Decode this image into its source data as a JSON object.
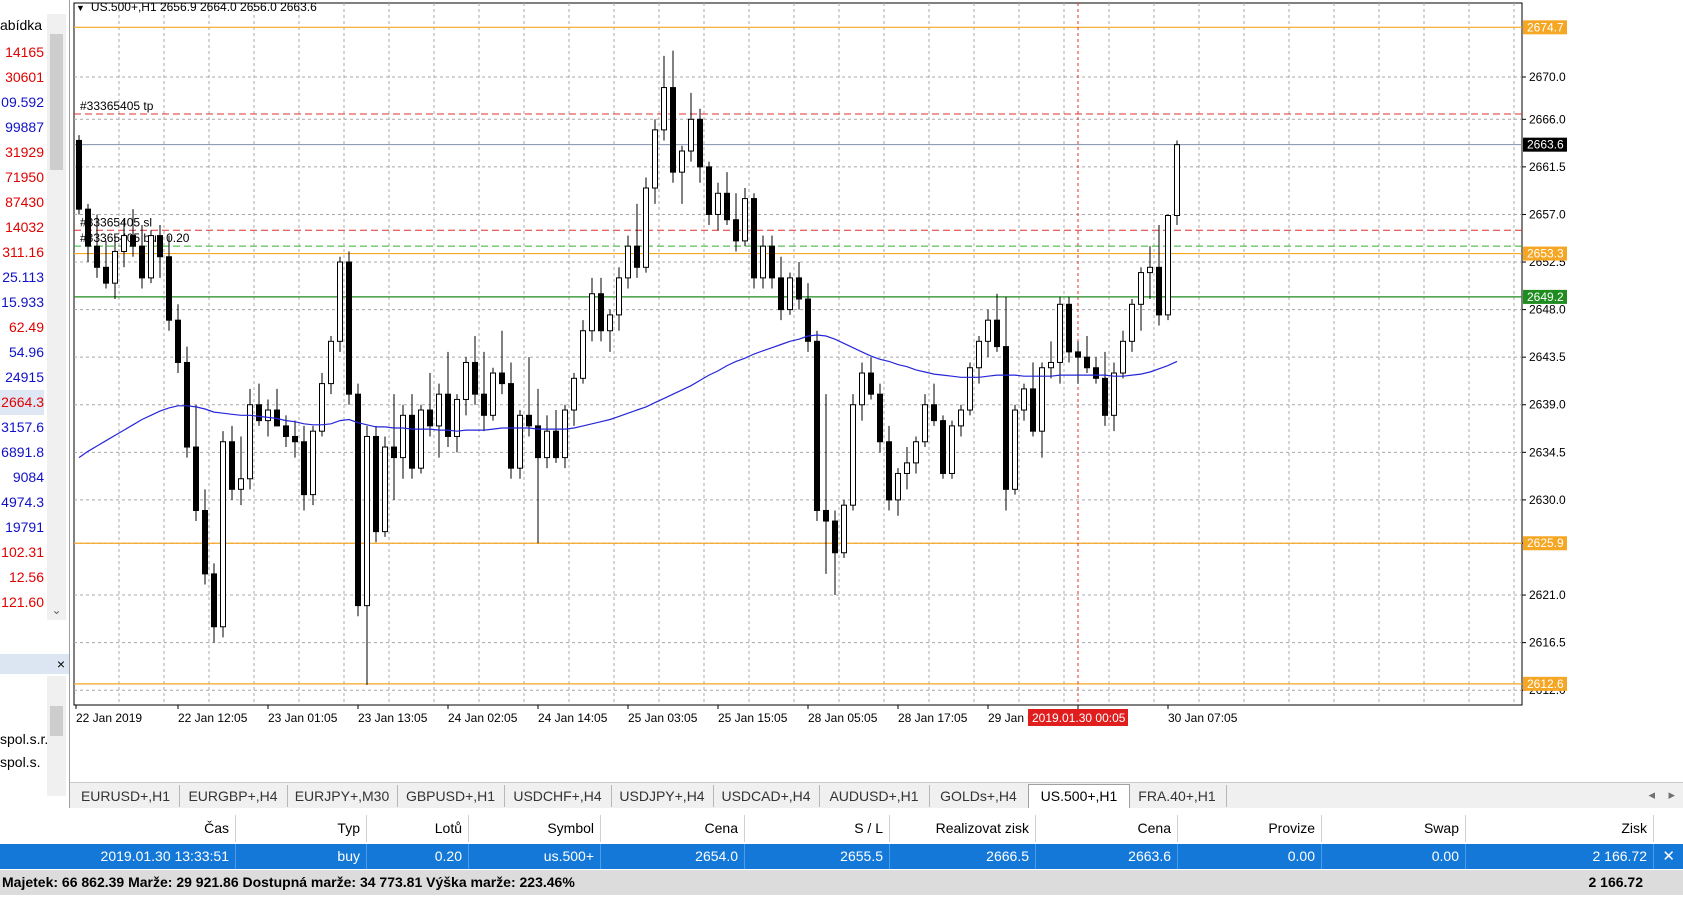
{
  "market_watch": {
    "header": "abídka",
    "rows": [
      {
        "value": "14165",
        "color": "#e00000"
      },
      {
        "value": "30601",
        "color": "#e00000"
      },
      {
        "value": "09.592",
        "color": "#1010c8"
      },
      {
        "value": "99887",
        "color": "#1010c8"
      },
      {
        "value": "31929",
        "color": "#e00000"
      },
      {
        "value": "71950",
        "color": "#e00000"
      },
      {
        "value": "87430",
        "color": "#e00000"
      },
      {
        "value": "14032",
        "color": "#e00000"
      },
      {
        "value": "311.16",
        "color": "#e00000"
      },
      {
        "value": "25.113",
        "color": "#1010c8"
      },
      {
        "value": "15.933",
        "color": "#1010c8"
      },
      {
        "value": "62.49",
        "color": "#e00000"
      },
      {
        "value": "54.96",
        "color": "#1010c8"
      },
      {
        "value": "24915",
        "color": "#1010c8"
      },
      {
        "value": "2664.3",
        "color": "#e00000"
      },
      {
        "value": "3157.6",
        "color": "#1010c8"
      },
      {
        "value": "6891.8",
        "color": "#1010c8"
      },
      {
        "value": "9084",
        "color": "#1010c8"
      },
      {
        "value": "4974.3",
        "color": "#1010c8"
      },
      {
        "value": "19791",
        "color": "#1010c8"
      },
      {
        "value": "102.31",
        "color": "#e00000"
      },
      {
        "value": "12.56",
        "color": "#e00000"
      },
      {
        "value": "121.60",
        "color": "#e00000"
      }
    ]
  },
  "navigator": {
    "close": "×",
    "account1": "spol.s.r.",
    "account2": "spol.s."
  },
  "chart": {
    "title": "US.500+,H1  2656.9 2664.0 2656.0 2663.6",
    "tp_label": "#33365405 tp",
    "sl_label": "#33365405 sl",
    "order_label": "#33365405 buy 0.20"
  },
  "chart_data": {
    "type": "candlestick",
    "symbol": "US.500+",
    "timeframe": "H1",
    "ylim": [
      2610.6,
      2677.0
    ],
    "y_ticks": [
      2670.0,
      2666.0,
      2661.5,
      2657.0,
      2652.5,
      2648.0,
      2643.5,
      2639.0,
      2634.5,
      2630.0,
      2625.9,
      2621.0,
      2616.5,
      2612.0
    ],
    "x_ticks": [
      "22 Jan 2019",
      "22 Jan 12:05",
      "23 Jan 01:05",
      "23 Jan 13:05",
      "24 Jan 02:05",
      "24 Jan 14:05",
      "25 Jan 03:05",
      "25 Jan 15:05",
      "28 Jan 05:05",
      "28 Jan 17:05",
      "29 Jan 06:05",
      "2019.01.30 00:05",
      "30 Jan 07:05"
    ],
    "x_tick_index": [
      0,
      11,
      21,
      31,
      41,
      51,
      61,
      71,
      81,
      91,
      101,
      111,
      121
    ],
    "highlight_time": "2019.01.30 00:05",
    "price_tags": [
      {
        "value": "2674.7",
        "color": "#f5a623",
        "text_color": "#ffffff"
      },
      {
        "value": "2663.6",
        "color": "#000000",
        "text_color": "#ffffff"
      },
      {
        "value": "2653.3",
        "color": "#f5a623",
        "text_color": "#ffffff"
      },
      {
        "value": "2649.2",
        "color": "#1e8c1e",
        "text_color": "#ffffff"
      },
      {
        "value": "2625.9",
        "color": "#f5a623",
        "text_color": "#ffffff"
      },
      {
        "value": "2612.6",
        "color": "#f5a623",
        "text_color": "#ffffff"
      }
    ],
    "levels": {
      "orange": [
        2674.7,
        2653.3,
        2625.9,
        2612.6
      ],
      "tp": 2666.5,
      "sl": 2655.5,
      "order": 2654.0,
      "green": 2649.2,
      "bid": 2663.6
    },
    "candles": [
      [
        2664.0,
        2664.5,
        2657.0,
        2657.5
      ],
      [
        2657.5,
        2658.0,
        2652.5,
        2654.0
      ],
      [
        2654.0,
        2657.0,
        2651.0,
        2652.0
      ],
      [
        2652.0,
        2654.5,
        2650.0,
        2650.5
      ],
      [
        2650.5,
        2655.0,
        2649.0,
        2653.5
      ],
      [
        2653.5,
        2656.5,
        2652.0,
        2655.0
      ],
      [
        2655.0,
        2657.5,
        2653.0,
        2654.0
      ],
      [
        2654.0,
        2656.0,
        2650.0,
        2651.0
      ],
      [
        2651.0,
        2655.5,
        2650.5,
        2655.0
      ],
      [
        2655.0,
        2656.0,
        2651.0,
        2653.0
      ],
      [
        2653.0,
        2655.0,
        2646.0,
        2647.0
      ],
      [
        2647.0,
        2648.5,
        2642.0,
        2643.0
      ],
      [
        2643.0,
        2644.5,
        2634.0,
        2635.0
      ],
      [
        2635.0,
        2639.0,
        2628.0,
        2629.0
      ],
      [
        2629.0,
        2631.0,
        2622.0,
        2623.0
      ],
      [
        2623.0,
        2624.0,
        2616.5,
        2618.0
      ],
      [
        2618.0,
        2636.5,
        2617.0,
        2635.5
      ],
      [
        2635.5,
        2637.0,
        2630.0,
        2631.0
      ],
      [
        2631.0,
        2636.0,
        2629.5,
        2632.0
      ],
      [
        2632.0,
        2640.5,
        2631.0,
        2639.0
      ],
      [
        2639.0,
        2641.0,
        2637.0,
        2637.5
      ],
      [
        2637.5,
        2639.5,
        2636.0,
        2638.5
      ],
      [
        2638.5,
        2640.5,
        2637.0,
        2637.0
      ],
      [
        2637.0,
        2638.0,
        2635.0,
        2636.0
      ],
      [
        2636.0,
        2637.5,
        2634.0,
        2635.5
      ],
      [
        2635.5,
        2637.0,
        2629.0,
        2630.5
      ],
      [
        2630.5,
        2637.0,
        2629.5,
        2636.5
      ],
      [
        2636.5,
        2642.0,
        2636.0,
        2641.0
      ],
      [
        2641.0,
        2645.5,
        2640.0,
        2645.0
      ],
      [
        2645.0,
        2653.0,
        2644.0,
        2652.5
      ],
      [
        2652.5,
        2653.5,
        2639.0,
        2640.0
      ],
      [
        2640.0,
        2641.0,
        2619.0,
        2620.0
      ],
      [
        2620.0,
        2637.0,
        2612.5,
        2636.0
      ],
      [
        2636.0,
        2637.0,
        2626.0,
        2627.0
      ],
      [
        2627.0,
        2636.0,
        2626.5,
        2635.0
      ],
      [
        2635.0,
        2640.0,
        2630.0,
        2634.0
      ],
      [
        2634.0,
        2639.0,
        2632.0,
        2638.0
      ],
      [
        2638.0,
        2640.0,
        2632.0,
        2633.0
      ],
      [
        2633.0,
        2639.0,
        2632.5,
        2638.5
      ],
      [
        2638.5,
        2642.0,
        2636.0,
        2637.0
      ],
      [
        2637.0,
        2641.0,
        2634.0,
        2640.0
      ],
      [
        2640.0,
        2644.0,
        2635.0,
        2636.0
      ],
      [
        2636.0,
        2640.0,
        2634.5,
        2639.5
      ],
      [
        2639.5,
        2643.5,
        2638.0,
        2643.0
      ],
      [
        2643.0,
        2645.5,
        2639.0,
        2640.0
      ],
      [
        2640.0,
        2644.0,
        2636.5,
        2638.0
      ],
      [
        2638.0,
        2642.5,
        2637.5,
        2642.0
      ],
      [
        2642.0,
        2646.0,
        2640.0,
        2641.0
      ],
      [
        2641.0,
        2643.0,
        2632.0,
        2633.0
      ],
      [
        2633.0,
        2638.5,
        2632.0,
        2638.0
      ],
      [
        2638.0,
        2643.5,
        2636.0,
        2637.0
      ],
      [
        2637.0,
        2640.5,
        2625.9,
        2634.0
      ],
      [
        2634.0,
        2638.0,
        2633.0,
        2636.5
      ],
      [
        2636.5,
        2638.5,
        2633.5,
        2634.0
      ],
      [
        2634.0,
        2639.0,
        2633.0,
        2638.5
      ],
      [
        2638.5,
        2642.0,
        2637.0,
        2641.5
      ],
      [
        2641.5,
        2647.0,
        2641.0,
        2646.0
      ],
      [
        2646.0,
        2651.0,
        2645.0,
        2649.5
      ],
      [
        2649.5,
        2651.0,
        2645.0,
        2646.0
      ],
      [
        2646.0,
        2648.0,
        2644.0,
        2647.5
      ],
      [
        2647.5,
        2652.0,
        2646.0,
        2651.0
      ],
      [
        2651.0,
        2655.0,
        2650.0,
        2654.0
      ],
      [
        2654.0,
        2658.0,
        2651.0,
        2652.0
      ],
      [
        2652.0,
        2660.5,
        2651.5,
        2659.5
      ],
      [
        2659.5,
        2666.0,
        2658.0,
        2665.0
      ],
      [
        2665.0,
        2672.0,
        2664.0,
        2669.0
      ],
      [
        2669.0,
        2672.5,
        2660.0,
        2661.0
      ],
      [
        2661.0,
        2663.5,
        2658.0,
        2663.0
      ],
      [
        2663.0,
        2668.5,
        2662.0,
        2666.0
      ],
      [
        2666.0,
        2667.0,
        2660.0,
        2661.5
      ],
      [
        2661.5,
        2662.0,
        2656.0,
        2657.0
      ],
      [
        2657.0,
        2660.0,
        2655.5,
        2659.0
      ],
      [
        2659.0,
        2661.0,
        2656.0,
        2656.5
      ],
      [
        2656.5,
        2659.0,
        2653.5,
        2654.5
      ],
      [
        2654.5,
        2659.5,
        2654.0,
        2658.5
      ],
      [
        2658.5,
        2659.0,
        2650.0,
        2651.0
      ],
      [
        2651.0,
        2655.0,
        2650.0,
        2654.0
      ],
      [
        2654.0,
        2655.0,
        2650.0,
        2651.0
      ],
      [
        2651.0,
        2653.0,
        2647.0,
        2648.0
      ],
      [
        2648.0,
        2651.5,
        2647.5,
        2651.0
      ],
      [
        2651.0,
        2652.5,
        2648.0,
        2649.0
      ],
      [
        2649.0,
        2650.5,
        2644.0,
        2645.0
      ],
      [
        2645.0,
        2646.0,
        2628.0,
        2629.0
      ],
      [
        2629.0,
        2640.0,
        2623.0,
        2628.0
      ],
      [
        2628.0,
        2629.0,
        2621.0,
        2625.0
      ],
      [
        2625.0,
        2630.0,
        2624.5,
        2629.5
      ],
      [
        2629.5,
        2640.0,
        2629.0,
        2639.0
      ],
      [
        2639.0,
        2643.0,
        2637.5,
        2642.0
      ],
      [
        2642.0,
        2643.5,
        2639.5,
        2640.0
      ],
      [
        2640.0,
        2641.0,
        2634.5,
        2635.5
      ],
      [
        2635.5,
        2637.0,
        2629.0,
        2630.0
      ],
      [
        2630.0,
        2633.0,
        2628.5,
        2632.5
      ],
      [
        2632.5,
        2635.0,
        2631.0,
        2633.5
      ],
      [
        2633.5,
        2636.0,
        2632.5,
        2635.5
      ],
      [
        2635.5,
        2640.0,
        2635.0,
        2639.0
      ],
      [
        2639.0,
        2641.0,
        2637.0,
        2637.5
      ],
      [
        2637.5,
        2638.0,
        2632.0,
        2632.5
      ],
      [
        2632.5,
        2637.5,
        2632.0,
        2637.0
      ],
      [
        2637.0,
        2639.0,
        2636.0,
        2638.5
      ],
      [
        2638.5,
        2643.0,
        2638.0,
        2642.5
      ],
      [
        2642.5,
        2645.5,
        2641.0,
        2645.0
      ],
      [
        2645.0,
        2648.0,
        2643.5,
        2647.0
      ],
      [
        2647.0,
        2649.5,
        2644.0,
        2644.5
      ],
      [
        2644.5,
        2649.2,
        2629.0,
        2631.0
      ],
      [
        2631.0,
        2639.0,
        2630.5,
        2638.5
      ],
      [
        2638.5,
        2641.0,
        2637.5,
        2640.5
      ],
      [
        2640.5,
        2643.0,
        2636.0,
        2636.5
      ],
      [
        2636.5,
        2643.0,
        2634.0,
        2642.5
      ],
      [
        2642.5,
        2645.0,
        2641.5,
        2643.0
      ],
      [
        2643.0,
        2649.2,
        2641.0,
        2648.5
      ],
      [
        2648.5,
        2649.2,
        2643.0,
        2644.0
      ],
      [
        2644.0,
        2645.0,
        2641.0,
        2643.5
      ],
      [
        2643.5,
        2645.5,
        2642.0,
        2642.5
      ],
      [
        2642.5,
        2643.5,
        2641.0,
        2641.5
      ],
      [
        2641.5,
        2644.0,
        2637.0,
        2638.0
      ],
      [
        2638.0,
        2643.0,
        2636.5,
        2642.0
      ],
      [
        2642.0,
        2646.0,
        2641.5,
        2645.0
      ],
      [
        2645.0,
        2649.0,
        2644.0,
        2648.5
      ],
      [
        2648.5,
        2652.0,
        2646.0,
        2651.5
      ],
      [
        2651.5,
        2654.0,
        2649.0,
        2652.0
      ],
      [
        2652.0,
        2656.0,
        2646.5,
        2647.5
      ],
      [
        2647.5,
        2657.0,
        2647.0,
        2656.9
      ],
      [
        2656.9,
        2664.0,
        2656.0,
        2663.6
      ]
    ],
    "ma": [
      2634.0,
      2634.6,
      2635.1,
      2635.6,
      2636.1,
      2636.6,
      2637.1,
      2637.6,
      2638.0,
      2638.4,
      2638.7,
      2638.9,
      2638.9,
      2638.8,
      2638.6,
      2638.3,
      2638.2,
      2638.1,
      2638.0,
      2638.0,
      2637.9,
      2637.8,
      2637.7,
      2637.5,
      2637.4,
      2637.2,
      2637.1,
      2637.1,
      2637.2,
      2637.5,
      2637.6,
      2637.3,
      2637.1,
      2636.9,
      2636.9,
      2636.8,
      2636.8,
      2636.7,
      2636.7,
      2636.7,
      2636.6,
      2636.6,
      2636.5,
      2636.6,
      2636.6,
      2636.6,
      2636.7,
      2636.8,
      2636.8,
      2636.8,
      2636.8,
      2636.7,
      2636.7,
      2636.7,
      2636.7,
      2636.8,
      2637.0,
      2637.2,
      2637.4,
      2637.6,
      2637.9,
      2638.2,
      2638.5,
      2638.8,
      2639.2,
      2639.6,
      2640.0,
      2640.4,
      2640.8,
      2641.3,
      2641.8,
      2642.2,
      2642.7,
      2643.1,
      2643.4,
      2643.8,
      2644.1,
      2644.4,
      2644.7,
      2645.0,
      2645.2,
      2645.5,
      2645.6,
      2645.5,
      2645.2,
      2644.8,
      2644.4,
      2644.0,
      2643.6,
      2643.3,
      2643.1,
      2642.8,
      2642.6,
      2642.3,
      2642.1,
      2641.9,
      2641.8,
      2641.7,
      2641.6,
      2641.6,
      2641.6,
      2641.7,
      2641.8,
      2641.8,
      2641.8,
      2641.7,
      2641.7,
      2641.7,
      2641.7,
      2641.8,
      2641.8,
      2641.8,
      2641.8,
      2641.8,
      2641.8,
      2641.7,
      2641.7,
      2641.8,
      2641.9,
      2642.1,
      2642.4,
      2642.7,
      2643.1
    ]
  },
  "tabs": [
    "EURUSD+,H1",
    "EURGBP+,H4",
    "EURJPY+,M30",
    "GBPUSD+,H1",
    "USDCHF+,H4",
    "USDJPY+,H4",
    "USDCAD+,H4",
    "AUDUSD+,H1",
    "GOLDs+,H4",
    "US.500+,H1",
    "FRA.40+,H1"
  ],
  "active_tab": "US.500+,H1",
  "tab_scroll": {
    "left": "◂",
    "right": "▸"
  },
  "terminal": {
    "columns": [
      {
        "label": "Čas",
        "right": 236
      },
      {
        "label": "Typ",
        "right": 367
      },
      {
        "label": "Lotů",
        "right": 469
      },
      {
        "label": "Symbol",
        "right": 601
      },
      {
        "label": "Cena",
        "right": 745
      },
      {
        "label": "S / L",
        "right": 890
      },
      {
        "label": "Realizovat zisk",
        "right": 1036
      },
      {
        "label": "Cena",
        "right": 1178
      },
      {
        "label": "Provize",
        "right": 1322
      },
      {
        "label": "Swap",
        "right": 1466
      },
      {
        "label": "Zisk",
        "right": 1654
      }
    ],
    "row": [
      "2019.01.30 13:33:51",
      "buy",
      "0.20",
      "us.500+",
      "2654.0",
      "2655.5",
      "2666.5",
      "2663.6",
      "0.00",
      "0.00",
      "2 166.72"
    ],
    "row_close": "✕",
    "summary": "Majetek: 66 862.39  Marže: 29 921.86  Dostupná marže: 34 773.81  Výška marže: 223.46%",
    "total_profit": "2 166.72"
  }
}
